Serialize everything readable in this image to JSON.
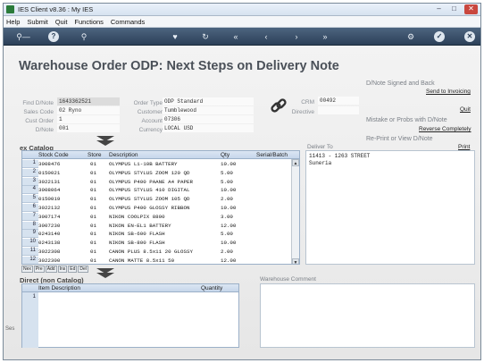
{
  "window": {
    "title": "IES Client v8.36 : My IES"
  },
  "menu": [
    "Help",
    "Submit",
    "Quit",
    "Functions",
    "Commands"
  ],
  "page_title": "Warehouse Order ODP: Next Steps on Delivery Note",
  "header_fields": {
    "find_dnote": {
      "label": "Find D/Note",
      "value": "1643362521"
    },
    "sales_code": {
      "label": "Sales Code",
      "value": "02 Ryno"
    },
    "cust_order": {
      "label": "Cust Order",
      "value": "1"
    },
    "dnote": {
      "label": "D/Note",
      "value": "001"
    },
    "order_type": {
      "label": "Order Type",
      "value": "ODP Standard"
    },
    "customer": {
      "label": "Customer",
      "value": "Tumblewood"
    },
    "account": {
      "label": "Account",
      "value": "07306"
    },
    "currency": {
      "label": "Currency",
      "value": "LOCAL USD"
    },
    "crm": {
      "label": "CRM",
      "value": "00492"
    },
    "directive": {
      "label": "Directive",
      "value": ""
    }
  },
  "actions": {
    "signed_back_title": "D/Note Signed and Back",
    "send_to_invoicing": "Send to Invoicing",
    "quit": "Quit",
    "mistake_title": "Mistake or Probs with D/Note",
    "reverse_completely": "Reverse Completely",
    "reprint_title": "Re-Print or View D/Note",
    "print": "Print"
  },
  "ex_catalog": {
    "title": "ex Catalog",
    "columns": [
      "Stock Code",
      "Store",
      "Description",
      "Qty",
      "Serial/Batch"
    ],
    "rows": [
      {
        "n": "1",
        "code": "3008476",
        "store": "01",
        "desc": "OLYMPUS Li-10B BATTERY",
        "qty": "10.00"
      },
      {
        "n": "2",
        "code": "0150021",
        "store": "01",
        "desc": "OLYMPUS STYLUS ZOOM 120 QD",
        "qty": "5.00"
      },
      {
        "n": "3",
        "code": "3022131",
        "store": "01",
        "desc": "OLYMPUS P400 PAANE A4 PAPER",
        "qty": "5.00"
      },
      {
        "n": "4",
        "code": "3008064",
        "store": "01",
        "desc": "OLYMPUS STYLUS 410 DIGITAL",
        "qty": "10.00"
      },
      {
        "n": "5",
        "code": "0150019",
        "store": "01",
        "desc": "OLYMPUS STYLUS ZOOM 105 QD",
        "qty": "2.00"
      },
      {
        "n": "6",
        "code": "3022132",
        "store": "01",
        "desc": "OLYMPUS P400 GLOSSY RIBBON",
        "qty": "10.00"
      },
      {
        "n": "7",
        "code": "3007174",
        "store": "01",
        "desc": "NIKON COOLPIX 8800",
        "qty": "3.00"
      },
      {
        "n": "8",
        "code": "3007230",
        "store": "01",
        "desc": "NIKON EN-EL1 BATTERY",
        "qty": "12.00"
      },
      {
        "n": "9",
        "code": "0243140",
        "store": "01",
        "desc": "NIKON SB-600 FLASH",
        "qty": "5.00"
      },
      {
        "n": "10",
        "code": "0243138",
        "store": "01",
        "desc": "NIKON SB-800 FLASH",
        "qty": "10.00"
      },
      {
        "n": "11",
        "code": "3022308",
        "store": "01",
        "desc": "CANON PLUS 8.5x11 20 GLOSSY",
        "qty": "2.00"
      },
      {
        "n": "12",
        "code": "3022300",
        "store": "01",
        "desc": "CANON MATTE 8.5x11 50",
        "qty": "12.00"
      }
    ],
    "tabs": [
      "Nex",
      "Pre",
      "Add",
      "Ins",
      "Ed",
      "Del"
    ]
  },
  "deliver_to": {
    "label": "Deliver To",
    "line1": "11413 - 1263 STREET",
    "line2": "Suneria"
  },
  "direct": {
    "title": "Direct (non Catalog)",
    "columns": [
      "Item Description",
      "Quantity"
    ],
    "row1": "1"
  },
  "warehouse_comment": {
    "label": "Warehouse Comment"
  },
  "left_edge_text": "Ses",
  "colors": {
    "toolbar": "#2c4058",
    "grid_header": "#c6d6ea",
    "heading": "#4a5058"
  }
}
